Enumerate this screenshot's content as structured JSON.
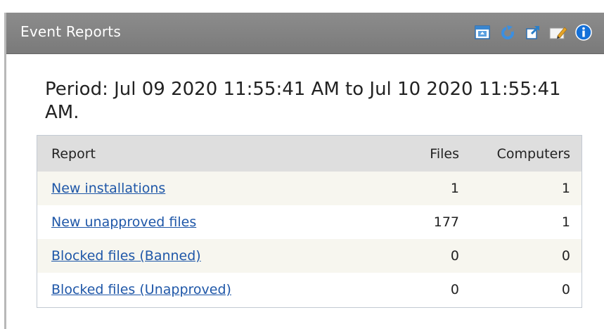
{
  "panel": {
    "title": "Event Reports",
    "toolbar": [
      {
        "icon": "panel-collapse-icon",
        "color": "#2a7fc9"
      },
      {
        "icon": "refresh-icon",
        "color": "#2f86d8"
      },
      {
        "icon": "popout-icon",
        "color": "#2a7fc9"
      },
      {
        "icon": "edit-icon",
        "color": "#e2a429"
      },
      {
        "icon": "info-icon",
        "color": "#1470d8"
      }
    ]
  },
  "period": {
    "text": "Period: Jul 09 2020 11:55:41 AM to Jul 10 2020 11:55:41 AM."
  },
  "table": {
    "headers": {
      "report": "Report",
      "files": "Files",
      "computers": "Computers"
    },
    "rows": [
      {
        "report": "New installations",
        "files": "1",
        "computers": "1"
      },
      {
        "report": "New unapproved files",
        "files": "177",
        "computers": "1"
      },
      {
        "report": "Blocked files (Banned)",
        "files": "0",
        "computers": "0"
      },
      {
        "report": "Blocked files (Unapproved)",
        "files": "0",
        "computers": "0"
      }
    ]
  },
  "colors": {
    "header_bg": "#858585",
    "link": "#1f57a8",
    "row_alt": "#f7f6ef",
    "table_header": "#dedede"
  }
}
